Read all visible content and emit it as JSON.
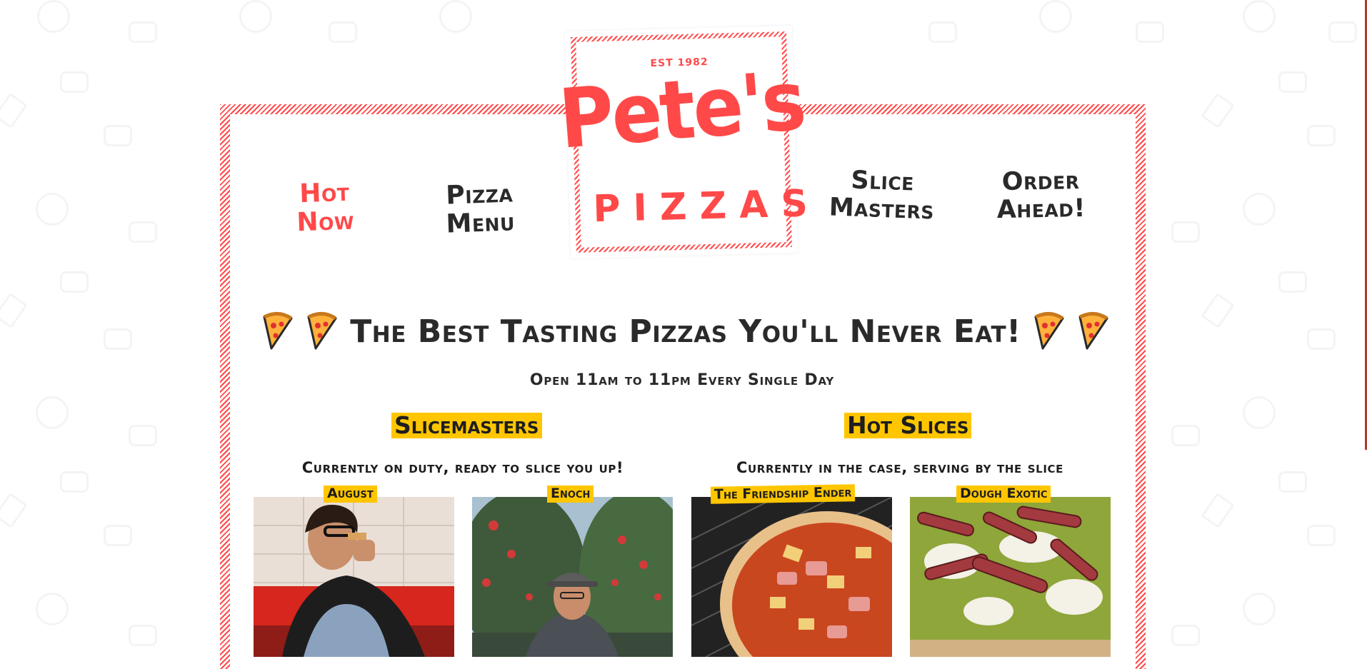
{
  "brand": {
    "est": "EST 1982",
    "name": "Pete's",
    "sub": "PIZZAS",
    "accent": "#ff4949",
    "highlight": "#ffc600"
  },
  "nav": {
    "hot_now": "Hot Now",
    "pizza_menu": "Pizza Menu",
    "slice_masters": "Slice Masters",
    "order_ahead": "Order Ahead!"
  },
  "hero": {
    "headline": "The Best Tasting Pizzas You'll Never Eat!",
    "hours": "Open 11am to 11pm Every Single Day"
  },
  "slicemasters": {
    "title": "Slicemasters",
    "subtitle": "Currently on duty, ready to slice you up!",
    "people": [
      {
        "name": "August"
      },
      {
        "name": "Enoch"
      }
    ]
  },
  "hot_slices": {
    "title": "Hot Slices",
    "subtitle": "Currently in the case, serving by the slice",
    "pizzas": [
      {
        "name": "The Friendship Ender"
      },
      {
        "name": "Dough Exotic"
      }
    ]
  },
  "icons": {
    "pizza": "pizza-slice-icon"
  }
}
